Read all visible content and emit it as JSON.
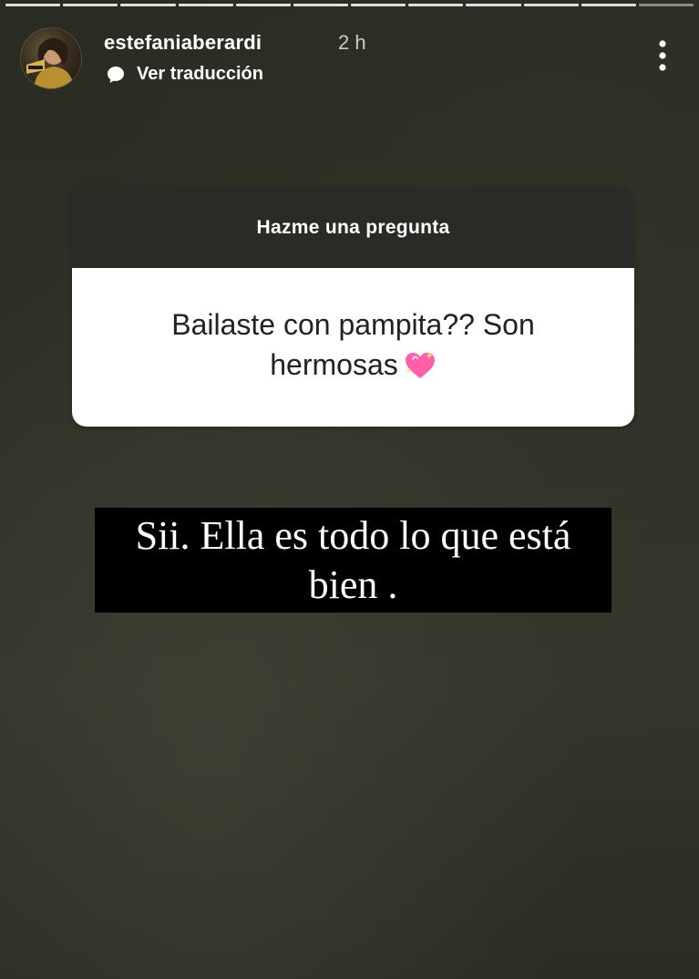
{
  "story": {
    "segments": 12,
    "username": "estefaniaberardi",
    "timestamp": "2 h",
    "translate_label": "Ver traducción",
    "icons": {
      "translate": "translate-bubble-icon",
      "more": "more-options-icon",
      "heart": "sparkling-heart-icon"
    }
  },
  "sticker": {
    "title": "Hazme una pregunta",
    "question": "Bailaste con pampita?? Son hermosas"
  },
  "answer": {
    "line1": "Sii. Ella es todo lo que está",
    "line2": "bien ."
  },
  "colors": {
    "sticker_header": "#2a2a27",
    "sticker_body": "#ffffff",
    "caption_bg": "#000000",
    "heart_pink": "#ff5fa8"
  }
}
